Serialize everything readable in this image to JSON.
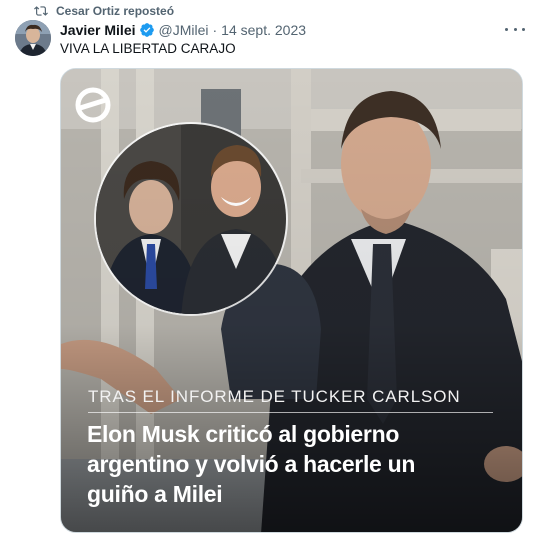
{
  "repost": {
    "label": "Cesar Ortiz reposteó"
  },
  "author": {
    "name": "Javier Milei",
    "handle": "@JMilei",
    "separator": "·",
    "date": "14 sept. 2023"
  },
  "tweet": {
    "text": "VIVA LA LIBERTAD CARAJO"
  },
  "media": {
    "kicker": "TRAS EL INFORME DE TUCKER CARLSON",
    "headline_lines": [
      "Elon Musk criticó al gobierno",
      "argentino y volvió a hacerle un",
      "guiño a Milei"
    ]
  },
  "colors": {
    "verified": "#1d9bf0",
    "secondary_text": "#536471",
    "primary_text": "#0f1419"
  },
  "icons": {
    "repost": "repost-icon",
    "verified": "verified-badge-icon",
    "more": "more-options-icon",
    "logo": "outlet-logo-icon"
  }
}
